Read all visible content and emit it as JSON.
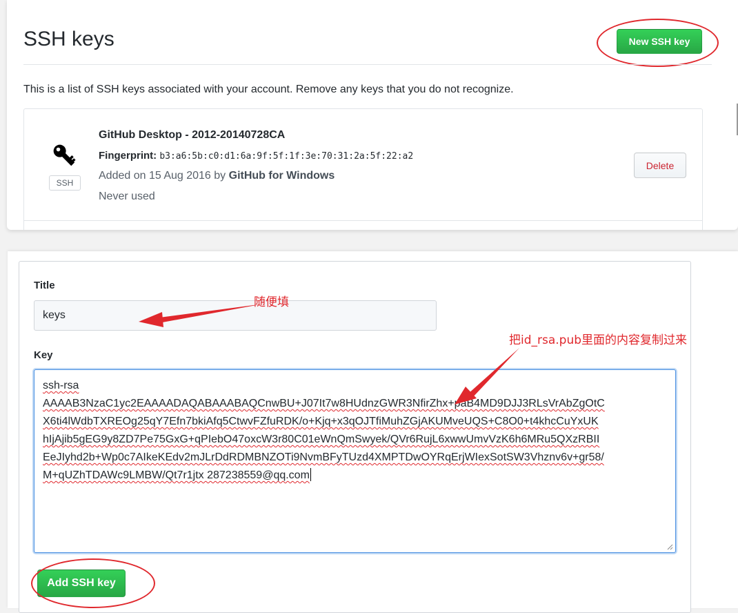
{
  "header": {
    "title": "SSH keys",
    "new_key_button": "New SSH key"
  },
  "intro_text": "This is a list of SSH keys associated with your account. Remove any keys that you do not recognize.",
  "keys": [
    {
      "name": "GitHub Desktop - 2012-20140728CA",
      "fingerprint_label": "Fingerprint:",
      "fingerprint": "b3:a6:5b:c0:d1:6a:9f:5f:1f:3e:70:31:2a:5f:22:a2",
      "added_prefix": "Added on 15 Aug 2016 by",
      "added_by": "GitHub for Windows",
      "last_used": "Never used",
      "type_label": "SSH",
      "delete_button": "Delete",
      "icon": "key-icon"
    }
  ],
  "form": {
    "title_label": "Title",
    "title_value": "keys",
    "key_label": "Key",
    "key_lines": [
      "ssh-rsa",
      "AAAAB3NzaC1yc2EAAAADAQABAAABAQCnwBU+J07It7w8HUdnzGWR3NfirZhx+paB4MD9DJJ3RLsVrAbZgOtC",
      "X6ti4lWdbTXREOg25qY7Efn7bkiAfq5CtwvFZfuRDK/o+Kjq+x3qOJTfiMuhZGjAKUMveUQS+C8O0+t4khcCuYxUK",
      "hIjAjib5gEG9y8ZD7Pe75GxG+qPIebO47oxcW3r80C01eWnQmSwyek/QVr6RujL6xwwUmvVzK6h6MRu5QXzRBII",
      "EeJIyhd2b+Wp0c7AIkeKEdv2mJLrDdRDMBNZOTi9NvmBFyTUzd4XMPTDwOYRqErjWIexSotSW3Vhznv6v+gr58/",
      "M+qUZhTDAWc9LMBW/Qt7r1jtx 287238559@qq.com"
    ],
    "add_button": "Add SSH key"
  },
  "annotations": {
    "title_hint": "随便填",
    "key_hint": "把id_rsa.pub里面的内容复制过来"
  },
  "colors": {
    "accent_green": "#28a745",
    "annotation_red": "#e0282d",
    "delete_red": "#cb2431"
  }
}
